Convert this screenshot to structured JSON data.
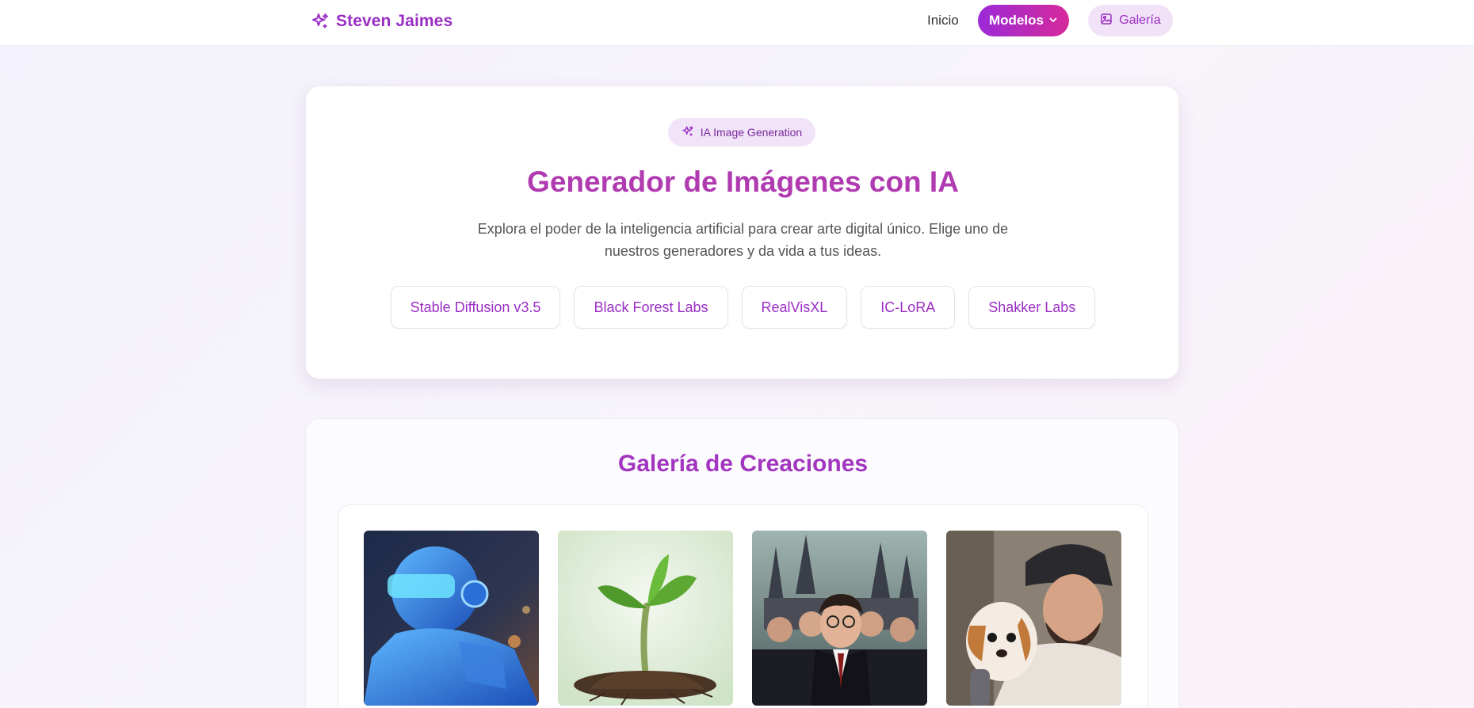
{
  "header": {
    "brand": "Steven Jaimes",
    "nav_inicio": "Inicio",
    "nav_modelos": "Modelos",
    "nav_galeria": "Galería"
  },
  "hero": {
    "badge": "IA Image Generation",
    "title": "Generador de Imágenes con IA",
    "description": "Explora el poder de la inteligencia artificial para crear arte digital único. Elige uno de nuestros generadores y da vida a tus ideas.",
    "models": [
      "Stable Diffusion v3.5",
      "Black Forest Labs",
      "RealVisXL",
      "IC-LoRA",
      "Shakker Labs"
    ]
  },
  "gallery": {
    "title": "Galería de Creaciones",
    "images": [
      {
        "name": "robot-image"
      },
      {
        "name": "plant-sprout-image"
      },
      {
        "name": "wizard-students-image"
      },
      {
        "name": "man-with-puppy-image"
      }
    ]
  },
  "colors": {
    "brand": "#9a2ec4",
    "accent_gradient_start": "#9b2ad8",
    "accent_gradient_end": "#d6299a"
  }
}
